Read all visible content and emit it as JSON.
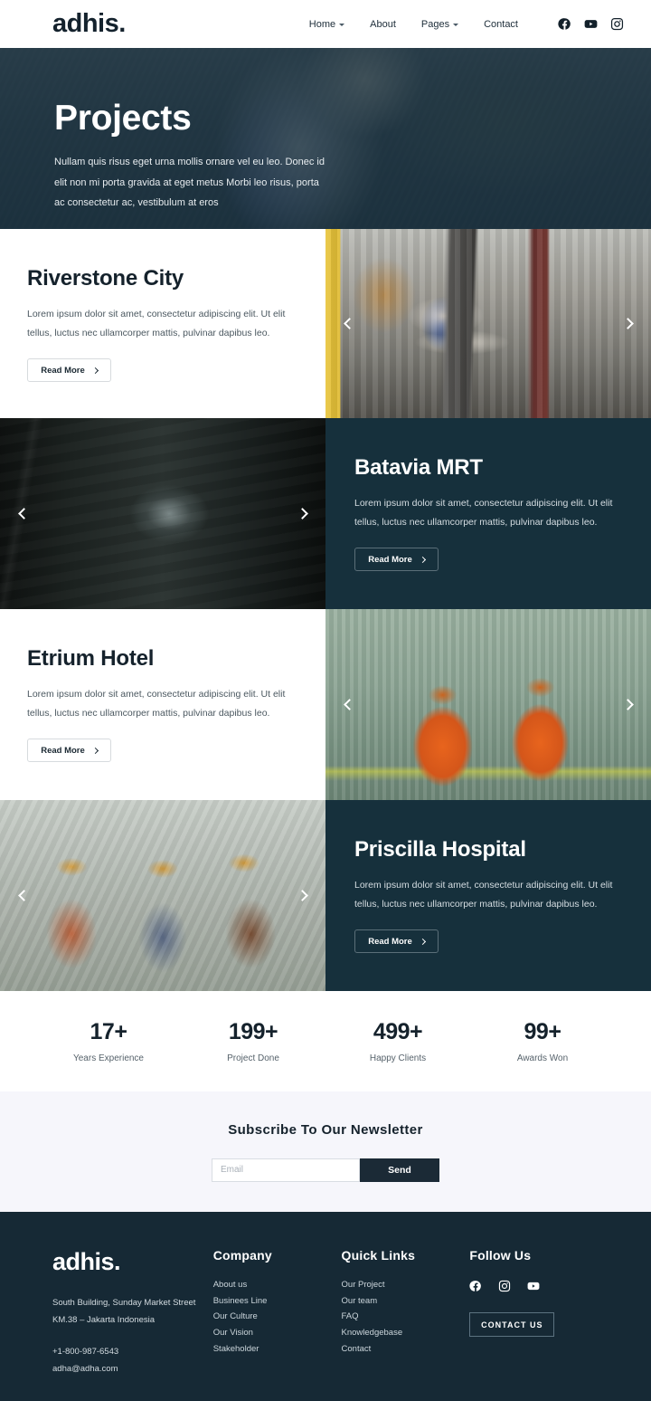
{
  "header": {
    "brand": "adhis.",
    "nav": [
      {
        "label": "Home",
        "has_dropdown": true
      },
      {
        "label": "About",
        "has_dropdown": false
      },
      {
        "label": "Pages",
        "has_dropdown": true
      },
      {
        "label": "Contact",
        "has_dropdown": false
      }
    ],
    "social": [
      "facebook-icon",
      "youtube-icon",
      "instagram-icon"
    ]
  },
  "hero": {
    "title": "Projects",
    "subtitle": "Nullam quis risus eget urna mollis ornare vel eu leo. Donec id elit non mi porta gravida at eget metus Morbi leo risus, porta ac consectetur ac, vestibulum at eros"
  },
  "projects": [
    {
      "title": "Riverstone City",
      "description": "Lorem ipsum dolor sit amet, consectetur adipiscing elit. Ut elit tellus, luctus nec ullamcorper mattis, pulvinar dapibus leo.",
      "cta": "Read More",
      "image_alt": "construction-site-crane"
    },
    {
      "title": "Batavia MRT",
      "description": "Lorem ipsum dolor sit amet, consectetur adipiscing elit. Ut elit tellus, luctus nec ullamcorper mattis, pulvinar dapibus leo.",
      "cta": "Read More",
      "image_alt": "metro-tunnel"
    },
    {
      "title": "Etrium Hotel",
      "description": "Lorem ipsum dolor sit amet, consectetur adipiscing elit. Ut elit tellus, luctus nec ullamcorper mattis, pulvinar dapibus leo.",
      "cta": "Read More",
      "image_alt": "workers-in-safety-vests"
    },
    {
      "title": "Priscilla Hospital",
      "description": "Lorem ipsum dolor sit amet, consectetur adipiscing elit. Ut elit tellus, luctus nec ullamcorper mattis, pulvinar dapibus leo.",
      "cta": "Read More",
      "image_alt": "team-reviewing-blueprints"
    }
  ],
  "stats": [
    {
      "value": "17+",
      "label": "Years Experience"
    },
    {
      "value": "199+",
      "label": "Project Done"
    },
    {
      "value": "499+",
      "label": "Happy Clients"
    },
    {
      "value": "99+",
      "label": "Awards Won"
    }
  ],
  "newsletter": {
    "title": "Subscribe To Our Newsletter",
    "input_placeholder": "Email",
    "input_value": "",
    "send_label": "Send"
  },
  "footer": {
    "brand": "adhis.",
    "address_line1": "South Building, Sunday Market Street",
    "address_line2": "KM.38 – Jakarta Indonesia",
    "phone": "+1-800-987-6543",
    "email": "adha@adha.com",
    "columns": [
      {
        "heading": "Company",
        "links": [
          "About us",
          "Businees Line",
          "Our Culture",
          "Our Vision",
          "Stakeholder"
        ]
      },
      {
        "heading": "Quick Links",
        "links": [
          "Our Project",
          "Our team",
          "FAQ",
          "Knowledgebase",
          "Contact"
        ]
      }
    ],
    "follow": {
      "heading": "Follow Us",
      "social": [
        "facebook-icon",
        "instagram-icon",
        "youtube-icon"
      ],
      "contact_button": "CONTACT US"
    }
  },
  "colors": {
    "dark": "#16303c",
    "footer_bg": "#162935",
    "newsletter_bg": "#f6f6fb",
    "text_dark": "#15222c",
    "send_button": "#1b2a36"
  }
}
